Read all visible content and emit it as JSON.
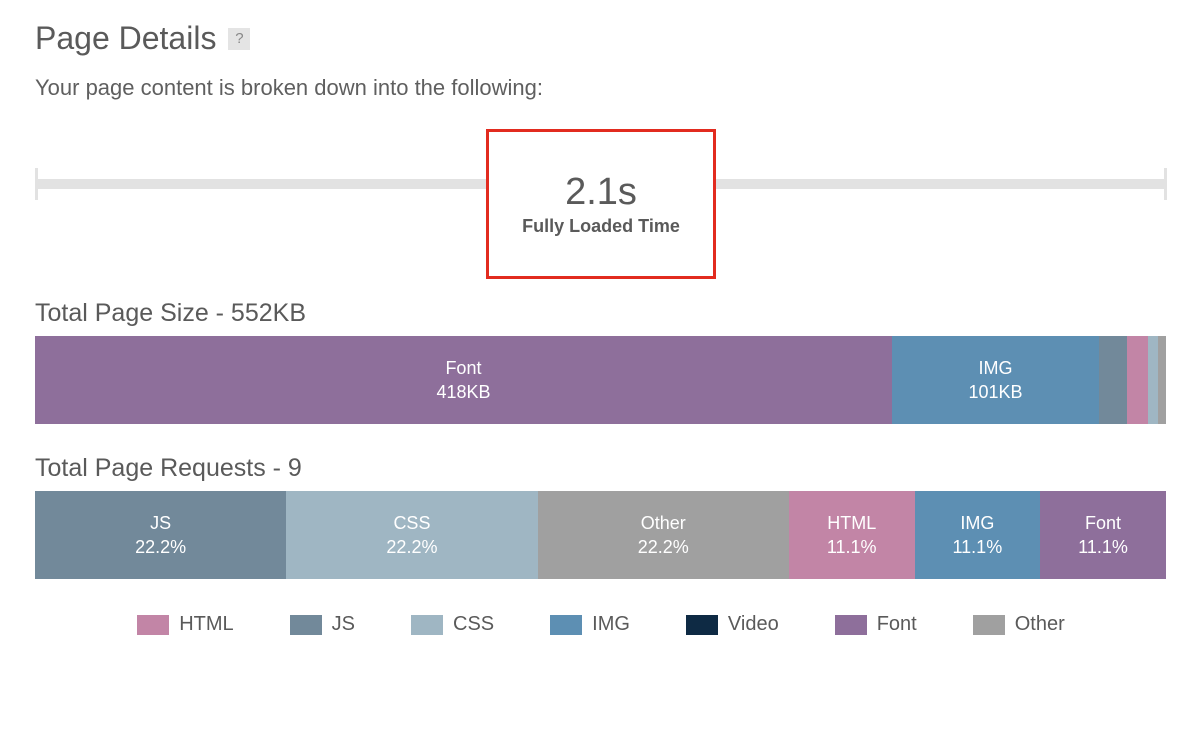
{
  "header": {
    "title": "Page Details",
    "help_glyph": "?",
    "subtitle": "Your page content is broken down into the following:"
  },
  "timeline": {
    "value": "2.1s",
    "label": "Fully Loaded Time"
  },
  "colors": {
    "HTML": "#c285a6",
    "JS": "#72899a",
    "CSS": "#9fb6c3",
    "IMG": "#5d8fb3",
    "Video": "#0e2a44",
    "Font": "#8e6f9b",
    "Other": "#a0a0a0"
  },
  "size_section": {
    "title": "Total Page Size - 552KB"
  },
  "requests_section": {
    "title": "Total Page Requests - 9"
  },
  "legend_order": [
    "HTML",
    "JS",
    "CSS",
    "IMG",
    "Video",
    "Font",
    "Other"
  ],
  "chart_data": [
    {
      "type": "bar",
      "title": "Total Page Size - 552KB",
      "unit": "KB",
      "total": 552,
      "segments": [
        {
          "name": "Font",
          "value_label": "418KB",
          "value": 418,
          "pct": 75.7
        },
        {
          "name": "IMG",
          "value_label": "101KB",
          "value": 101,
          "pct": 18.3
        },
        {
          "name": "JS",
          "value_label": "",
          "value": 14,
          "pct": 2.5
        },
        {
          "name": "HTML",
          "value_label": "",
          "value": 10,
          "pct": 1.8
        },
        {
          "name": "CSS",
          "value_label": "",
          "value": 5,
          "pct": 0.9
        },
        {
          "name": "Other",
          "value_label": "",
          "value": 4,
          "pct": 0.7
        }
      ]
    },
    {
      "type": "bar",
      "title": "Total Page Requests - 9",
      "unit": "requests",
      "total": 9,
      "segments": [
        {
          "name": "JS",
          "value_label": "22.2%",
          "value": 2,
          "pct": 22.2
        },
        {
          "name": "CSS",
          "value_label": "22.2%",
          "value": 2,
          "pct": 22.2
        },
        {
          "name": "Other",
          "value_label": "22.2%",
          "value": 2,
          "pct": 22.2
        },
        {
          "name": "HTML",
          "value_label": "11.1%",
          "value": 1,
          "pct": 11.1
        },
        {
          "name": "IMG",
          "value_label": "11.1%",
          "value": 1,
          "pct": 11.1
        },
        {
          "name": "Font",
          "value_label": "11.1%",
          "value": 1,
          "pct": 11.1
        }
      ]
    }
  ]
}
